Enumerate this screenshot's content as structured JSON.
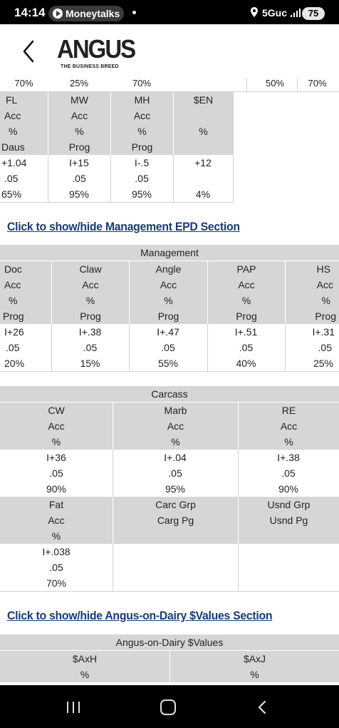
{
  "status_bar": {
    "time": "14:14",
    "notification_app": "Moneytalks",
    "network": "5Guc",
    "battery": "75"
  },
  "header": {
    "logo_text": "ANGUS",
    "logo_tagline": "THE BUSINESS BREED"
  },
  "top_table": {
    "cut_off_values": [
      "70%",
      "25%",
      "70%",
      "50%",
      "70%"
    ],
    "headers": [
      [
        "FL",
        "Acc",
        "%",
        "Daus"
      ],
      [
        "MW",
        "Acc",
        "%",
        "Prog"
      ],
      [
        "MH",
        "Acc",
        "%",
        "Prog"
      ],
      [
        "$EN",
        "",
        "%",
        ""
      ]
    ],
    "values": [
      [
        "+1.04",
        ".05",
        "65%"
      ],
      [
        "I+15",
        ".05",
        "95%"
      ],
      [
        "I-.5",
        ".05",
        "95%"
      ],
      [
        "+12",
        "",
        "4%"
      ]
    ]
  },
  "management_link": "Click to show/hide Management EPD Section",
  "management": {
    "title": "Management",
    "headers": [
      [
        "Doc",
        "Acc",
        "%",
        "Prog"
      ],
      [
        "Claw",
        "Acc",
        "%",
        "Prog"
      ],
      [
        "Angle",
        "Acc",
        "%",
        "Prog"
      ],
      [
        "PAP",
        "Acc",
        "%",
        "Prog"
      ],
      [
        "HS",
        "Acc",
        "%",
        "Prog"
      ]
    ],
    "values": [
      [
        "I+26",
        ".05",
        "20%"
      ],
      [
        "I+.38",
        ".05",
        "15%"
      ],
      [
        "I+.47",
        ".05",
        "55%"
      ],
      [
        "I+.51",
        ".05",
        "40%"
      ],
      [
        "I+.31",
        ".05",
        "25%"
      ]
    ]
  },
  "carcass": {
    "title": "Carcass",
    "headers_1": [
      [
        "CW",
        "Acc",
        "%"
      ],
      [
        "Marb",
        "Acc",
        "%"
      ],
      [
        "RE",
        "Acc",
        "%"
      ]
    ],
    "values_1": [
      [
        "I+36",
        ".05",
        "90%"
      ],
      [
        "I+.04",
        ".05",
        "95%"
      ],
      [
        "I+.38",
        ".05",
        "90%"
      ]
    ],
    "headers_2": [
      [
        "Fat",
        "Acc",
        "%"
      ],
      [
        "Carc Grp",
        "Carg Pg",
        ""
      ],
      [
        "Usnd Grp",
        "Usnd Pg",
        ""
      ]
    ],
    "values_2": [
      [
        "I+.038",
        ".05",
        "70%"
      ],
      [
        "",
        "",
        ""
      ],
      [
        "",
        "",
        ""
      ]
    ]
  },
  "dairy_link": "Click to show/hide Angus-on-Dairy $Values Section",
  "dairy": {
    "title": "Angus-on-Dairy $Values",
    "headers": [
      [
        "$AxH",
        "%"
      ],
      [
        "$AxJ",
        "%"
      ]
    ]
  },
  "colors": {
    "header_bg": "#d6d6d6",
    "link": "#1a3b7a",
    "status_bar": "#000000"
  }
}
